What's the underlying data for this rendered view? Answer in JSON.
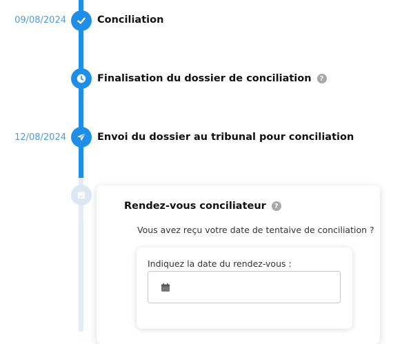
{
  "timeline": {
    "steps": [
      {
        "date": "09/08/2024",
        "title": "Conciliation",
        "icon": "check-icon",
        "status": "done"
      },
      {
        "date": "",
        "title": "Finalisation du dossier de conciliation",
        "icon": "clock-icon",
        "status": "done",
        "help": "?"
      },
      {
        "date": "12/08/2024",
        "title": "Envoi du dossier au tribunal pour conciliation",
        "icon": "paper-plane-icon",
        "status": "done"
      },
      {
        "date": "",
        "title": "Rendez-vous conciliateur",
        "icon": "calendar-icon",
        "status": "pending",
        "help": "?"
      }
    ]
  },
  "card": {
    "title": "Rendez-vous conciliateur",
    "help": "?",
    "question": "Vous avez reçu votre date de tentaive de conciliation ?",
    "field_label": "Indiquez la date du rendez-vous :",
    "date_value": ""
  },
  "colors": {
    "accent": "#1f8ee6",
    "date_text": "#4f9bd6",
    "pending_node": "#dde7f3",
    "pending_rail": "#e3ecf7"
  }
}
